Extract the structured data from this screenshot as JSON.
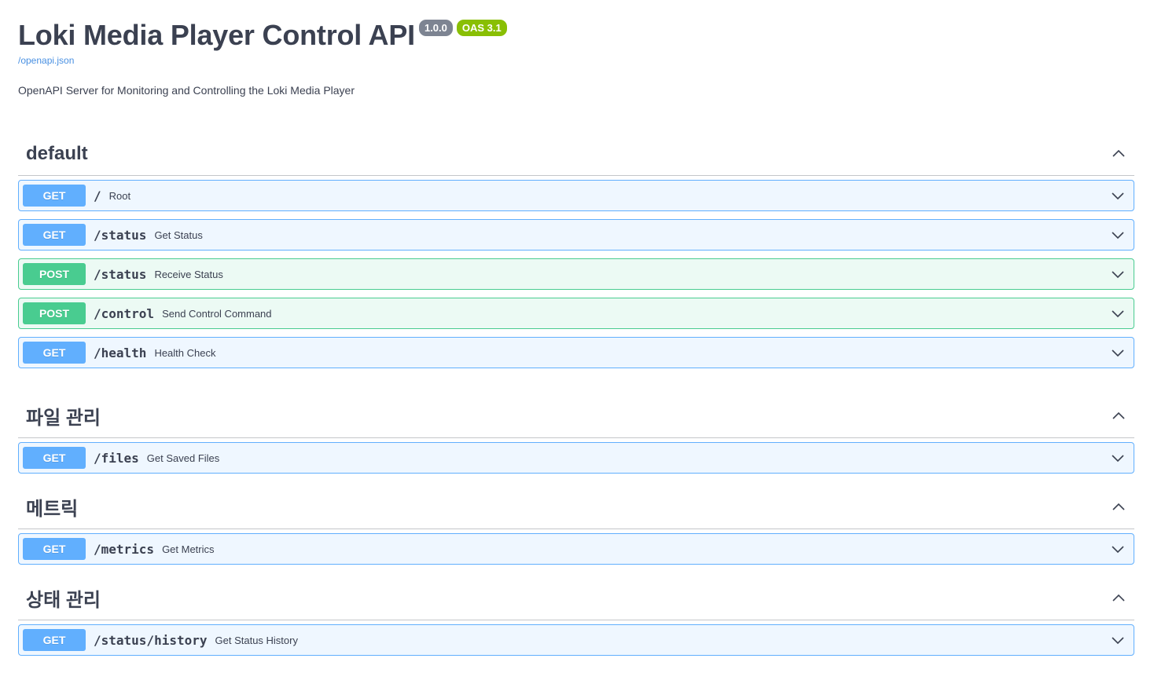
{
  "info": {
    "title": "Loki Media Player Control API",
    "version_badge": "1.0.0",
    "oas_badge": "OAS 3.1",
    "spec_link": "/openapi.json",
    "description": "OpenAPI Server for Monitoring and Controlling the Loki Media Player"
  },
  "colors": {
    "get": "#61affe",
    "post": "#49cc90",
    "version_badge": "#7d8492",
    "oas_badge": "#89bf04",
    "link": "#4990e2"
  },
  "icons": {
    "tag_toggle": "chevron-up-icon",
    "operation_toggle": "chevron-down-icon"
  },
  "tags": [
    {
      "name": "default",
      "operations": [
        {
          "method": "GET",
          "path": "/",
          "summary": "Root"
        },
        {
          "method": "GET",
          "path": "/status",
          "summary": "Get Status"
        },
        {
          "method": "POST",
          "path": "/status",
          "summary": "Receive Status"
        },
        {
          "method": "POST",
          "path": "/control",
          "summary": "Send Control Command"
        },
        {
          "method": "GET",
          "path": "/health",
          "summary": "Health Check"
        }
      ]
    },
    {
      "name": "파일 관리",
      "operations": [
        {
          "method": "GET",
          "path": "/files",
          "summary": "Get Saved Files"
        }
      ]
    },
    {
      "name": "메트릭",
      "operations": [
        {
          "method": "GET",
          "path": "/metrics",
          "summary": "Get Metrics"
        }
      ]
    },
    {
      "name": "상태 관리",
      "operations": [
        {
          "method": "GET",
          "path": "/status/history",
          "summary": "Get Status History"
        }
      ]
    }
  ]
}
